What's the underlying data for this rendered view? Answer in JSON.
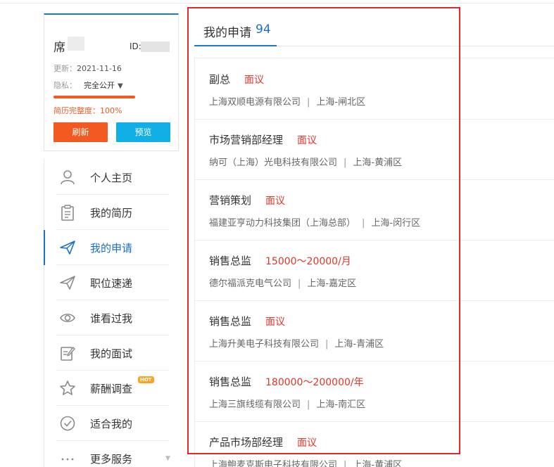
{
  "profile": {
    "name": "席",
    "id_label": "ID:",
    "updated_label": "更新：",
    "updated_value": "2021-11-16",
    "privacy_label": "隐私：",
    "privacy_value": "完全公开",
    "completeness_text": "简历完整度：100%",
    "completeness": 1.0,
    "refresh_label": "刷新",
    "preview_label": "预览"
  },
  "sidebar": {
    "items": [
      {
        "label": "个人主页",
        "icon": "user-icon"
      },
      {
        "label": "我的简历",
        "icon": "clipboard-icon"
      },
      {
        "label": "我的申请",
        "icon": "paper-plane-icon",
        "active": true
      },
      {
        "label": "职位速递",
        "icon": "send-icon"
      },
      {
        "label": "谁看过我",
        "icon": "eye-icon"
      },
      {
        "label": "我的面试",
        "icon": "edit-icon"
      },
      {
        "label": "薪酬调查",
        "icon": "star-icon",
        "badge": "HOT"
      },
      {
        "label": "适合我的",
        "icon": "check-circle-icon"
      },
      {
        "label": "更多服务",
        "icon": "more-icon"
      }
    ]
  },
  "applications": {
    "title": "我的申请",
    "count": "94",
    "jobs": [
      {
        "title": "副总",
        "salary": "面议",
        "company": "上海双顺电源有限公司",
        "location": "上海-闸北区"
      },
      {
        "title": "市场营销部经理",
        "salary": "面议",
        "company": "纳可（上海）光电科技有限公司",
        "location": "上海-黄浦区"
      },
      {
        "title": "营销策划",
        "salary": "面议",
        "company": "福建亚亨动力科技集团（上海总部）",
        "location": "上海-闵行区"
      },
      {
        "title": "销售总监",
        "salary": "15000～20000/月",
        "company": "德尔福派克电气公司",
        "location": "上海-嘉定区"
      },
      {
        "title": "销售总监",
        "salary": "面议",
        "company": "上海升美电子科技有限公司",
        "location": "上海-青浦区"
      },
      {
        "title": "销售总监",
        "salary": "180000～200000/年",
        "company": "上海三旗线缆有限公司",
        "location": "上海-南汇区"
      },
      {
        "title": "产品市场部经理",
        "salary": "面议",
        "company": "上海鲍麦克斯电子科技有限公司",
        "location": "上海-黄浦区"
      }
    ]
  },
  "colors": {
    "accent_blue": "#1e6fc2",
    "orange": "#f25a22",
    "cyan": "#12aee6",
    "salary_red": "#e0362b",
    "highlight_outline": "#e0282e"
  }
}
